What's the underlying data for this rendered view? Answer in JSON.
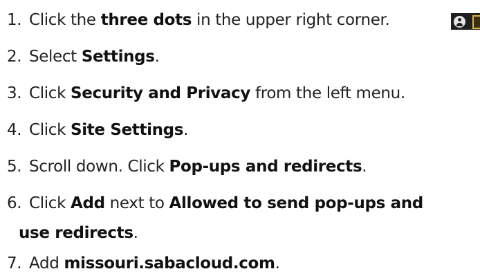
{
  "instructions": {
    "steps": [
      {
        "number": "1.",
        "before": "Click the ",
        "bold": "three dots",
        "after": " in the upper right corner."
      },
      {
        "number": "2.",
        "before": "Select ",
        "bold": "Settings",
        "after": "."
      },
      {
        "number": "3.",
        "before": "Click ",
        "bold": "Security and Privacy",
        "after": " from the left menu."
      },
      {
        "number": "4.",
        "before": "Click ",
        "bold": "Site Settings",
        "after": "."
      },
      {
        "number": "5.",
        "before": "Scroll down. Click ",
        "bold": "Pop-ups and redirects",
        "after": "."
      },
      {
        "number": "6.",
        "before": "Click ",
        "bold": "Add",
        "middle": " next to ",
        "bold2": "Allowed to send pop-ups and",
        "cont_bold": "use redirects",
        "cont_after": "."
      },
      {
        "number": "7.",
        "before": "Add ",
        "bold": "missouri.sabacloud.com",
        "after": "."
      }
    ]
  },
  "thumbnail": {
    "icons": [
      "avatar-icon",
      "folder-icon"
    ],
    "colors": {
      "background": "#1f1f1f",
      "avatar": "#e6e6e6",
      "folder": "#e3b23c"
    }
  },
  "colors": {
    "text": "#222222",
    "background": "#ffffff"
  }
}
